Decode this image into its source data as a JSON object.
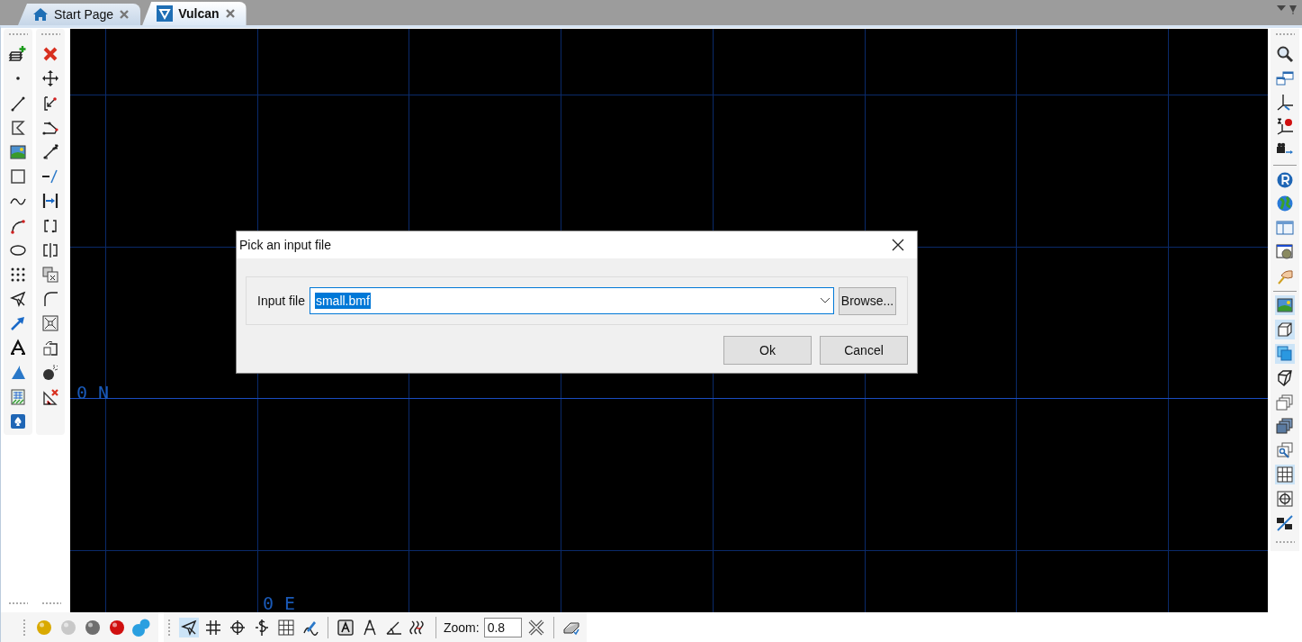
{
  "tabs": [
    {
      "label": "Start Page",
      "selected": false
    },
    {
      "label": "Vulcan",
      "selected": true
    }
  ],
  "right_toolbar": {
    "groups": [
      [
        {
          "selected": false
        },
        {
          "selected": false
        },
        {
          "selected": false
        },
        {
          "selected": false
        },
        {
          "selected": false
        }
      ],
      [
        {
          "selected": false
        },
        {
          "selected": false
        },
        {
          "selected": false
        },
        {
          "selected": false
        },
        {
          "selected": false
        }
      ],
      [
        {
          "selected": true
        },
        {
          "selected": true
        },
        {
          "selected": true
        },
        {
          "selected": false
        },
        {
          "selected": false
        },
        {
          "selected": false
        },
        {
          "selected": false
        },
        {
          "selected": true
        },
        {
          "selected": false
        },
        {
          "selected": false
        }
      ]
    ]
  },
  "canvas": {
    "axis_labels": [
      "0 N",
      "0 E"
    ]
  },
  "dialog": {
    "title": "Pick an input file",
    "field_label": "Input file",
    "value": "small.bmf",
    "value_selected": true,
    "buttons": [
      "Browse...",
      "Ok",
      "Cancel"
    ]
  },
  "bottom_toolbar": {
    "materials": [
      {
        "color": "#d9a900"
      },
      {
        "color": "#c8c8c8"
      },
      {
        "color": "#6e6e6e"
      },
      {
        "color": "#d01010"
      },
      {
        "color": "#2a9fe0"
      }
    ],
    "tools": [
      {
        "selected": true
      },
      {
        "selected": false
      },
      {
        "selected": false
      },
      {
        "selected": false
      },
      {
        "selected": false
      },
      {
        "selected": false
      }
    ],
    "zoom_label": "Zoom:",
    "zoom_value": "0.8"
  }
}
